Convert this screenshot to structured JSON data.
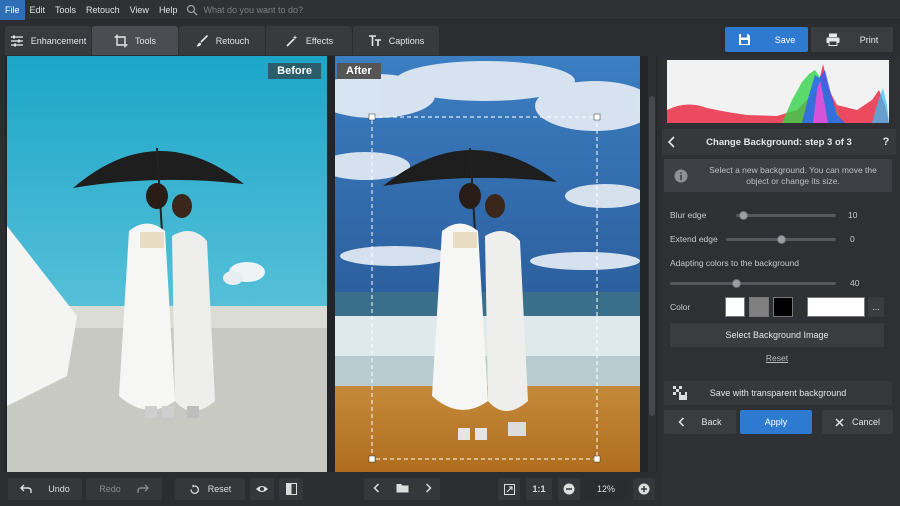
{
  "menu": {
    "items": [
      "File",
      "Edit",
      "Tools",
      "Retouch",
      "View",
      "Help"
    ],
    "search_placeholder": "What do you want to do?"
  },
  "tabs": [
    {
      "label": "Enhancement",
      "icon": "sliders-icon"
    },
    {
      "label": "Tools",
      "icon": "crop-icon"
    },
    {
      "label": "Retouch",
      "icon": "brush-icon"
    },
    {
      "label": "Effects",
      "icon": "magic-wand-icon"
    },
    {
      "label": "Captions",
      "icon": "text-icon"
    }
  ],
  "actions": {
    "save_label": "Save",
    "print_label": "Print"
  },
  "canvas": {
    "before_label": "Before",
    "after_label": "After"
  },
  "bottom": {
    "undo_label": "Undo",
    "redo_label": "Redo",
    "reset_label": "Reset",
    "fit_label": "1:1",
    "zoom_value": "12%"
  },
  "panel": {
    "step_title": "Change Background: step 3 of 3",
    "help_label": "?",
    "info_text": "Select a new background. You can move the object or change its size.",
    "blur_edge": {
      "label": "Blur edge",
      "value": "10",
      "level": 0.07
    },
    "extend_edge": {
      "label": "Extend edge",
      "value": "0",
      "level": 0.5
    },
    "adapt": {
      "label": "Adapting colors to the background",
      "value": "40",
      "level": 0.4
    },
    "color_label": "Color",
    "color_swatches": [
      "#ffffff",
      "#808080",
      "#000000"
    ],
    "color_selected": "#ffffff",
    "more_label": "...",
    "select_bg_label": "Select Background Image",
    "reset_link": "Reset",
    "save_transparent_label": "Save with transparent background",
    "back_label": "Back",
    "apply_label": "Apply",
    "cancel_label": "Cancel"
  },
  "colors": {
    "accent": "#2e7ad1",
    "panel": "#2e3034"
  }
}
